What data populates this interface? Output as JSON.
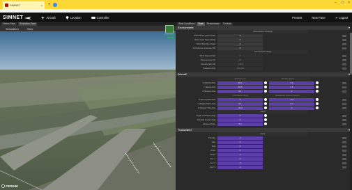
{
  "browser": {
    "tab_title": "SIMNET",
    "new_tab": "+"
  },
  "app": {
    "logo": "SIMNET",
    "nav": [
      {
        "label": "Aircraft",
        "icon": "airplane-icon"
      },
      {
        "label": "Location",
        "icon": "location-pin-icon"
      },
      {
        "label": "Controller",
        "icon": "gamepad-icon"
      }
    ],
    "right_nav": [
      "Presets",
      "New Pane",
      "Logout"
    ]
  },
  "left_pane": {
    "tabs": [
      "Viewer Pane",
      "Simulation Pane"
    ],
    "menu": [
      "Simulation",
      "View"
    ],
    "attribution": "CESIUM",
    "fps": [
      "35.25 FPS",
      "28 MS"
    ]
  },
  "right_pane": {
    "tabs": [
      "Wind Conditions",
      "State",
      "Performance",
      "Controls"
    ],
    "environment": {
      "title": "Environment",
      "atmosphere_settings": "Atmosphere Settings",
      "settings_rows": [
        {
          "label": "Wind Mean Speed [kts]",
          "value": "0"
        },
        {
          "label": "Wind Gust Speed [kts]",
          "value": "0"
        },
        {
          "label": "Wind Direction [deg]",
          "value": "0"
        },
        {
          "label": "Turbulence Intensity [%]",
          "value": "0"
        }
      ],
      "atmosphere_state": "Atmospheric State",
      "state_rows": [
        {
          "label": "Wind Speed [kts]",
          "value": "0"
        },
        {
          "label": "Temperature [C]",
          "value": "15"
        },
        {
          "label": "Density [kg/m3]",
          "value": "1.224"
        },
        {
          "label": "Pressure [Pa]",
          "value": "101,324"
        }
      ]
    },
    "aircraft": {
      "title": "Aircraft",
      "col_position": "Position [m]",
      "col_velocity": "Velocity [m/s]",
      "position_rows": [
        {
          "label": "X (North) Axis",
          "pos": "28.4",
          "vel": "2.9"
        },
        {
          "label": "Y (East) Axis",
          "pos": "58.5",
          "vel": "4.5"
        },
        {
          "label": "Z (Down) Axis",
          "pos": "0.1",
          "vel": "0"
        }
      ],
      "col_orientation": "Orientation [deg]",
      "col_rot": "Rotational Velocity [deg/s]",
      "orientation_rows": [
        {
          "label": "X (Front) Roll Axis",
          "ori": "0",
          "rot": "-0.5"
        },
        {
          "label": "Y (Right) Pitch Axis",
          "ori": "0.1",
          "rot": "0.4"
        },
        {
          "label": "Z (Down) Yaw Axis",
          "ori": "-32.6",
          "rot": "0"
        }
      ],
      "col_other": "Other",
      "other_rows": [
        {
          "label": "Angle of Attack [deg]",
          "value": "0"
        },
        {
          "label": "Sideslip Angle [deg]",
          "value": "0"
        },
        {
          "label": "Airspeed [kts]",
          "value": "5.4"
        }
      ]
    },
    "transmitter": {
      "title": "Transmitter",
      "col": "Input",
      "rows": [
        {
          "label": "Throttle",
          "value": "-1"
        },
        {
          "label": "Yaw",
          "value": "0"
        },
        {
          "label": "Roll",
          "value": "0"
        },
        {
          "label": "Pitch",
          "value": "0"
        },
        {
          "label": "Flaps",
          "value": "-1"
        },
        {
          "label": "Aux 1",
          "value": "-1"
        },
        {
          "label": "Aux 2",
          "value": "-1"
        },
        {
          "label": "Aux 3",
          "value": "-1"
        }
      ]
    }
  },
  "colors": {
    "chrome": "#fdd835",
    "accent": "#5b3ea8",
    "topbar": "#111111"
  }
}
